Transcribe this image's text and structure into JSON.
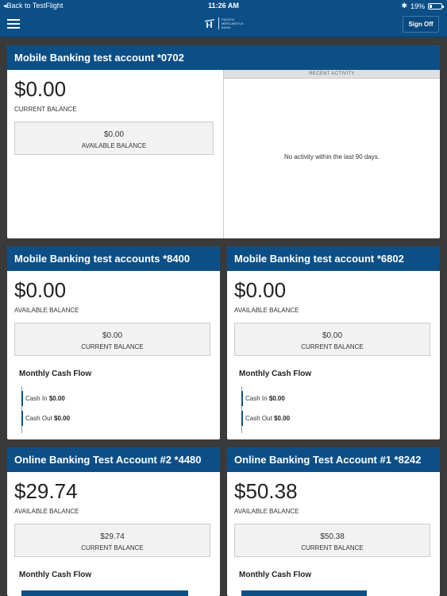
{
  "status_bar": {
    "back": "Back to TestFlight",
    "time": "11:26 AM",
    "bluetooth": "✱",
    "battery": "19%"
  },
  "nav": {
    "logo_text": [
      "PACIFIC",
      "MERCANTILE",
      "BANK"
    ],
    "sign_off": "Sign Off"
  },
  "accounts": [
    {
      "title": "Mobile Banking test account *0702",
      "amount": "$0.00",
      "amount_label": "CURRENT BALANCE",
      "sub_amount": "$0.00",
      "sub_label": "AVAILABLE BALANCE",
      "recent_activity_header": "RECENT ACTIVITY",
      "recent_activity_message": "No activity within the last 90 days."
    },
    {
      "title": "Mobile Banking test accounts *8400",
      "amount": "$0.00",
      "amount_label": "AVAILABLE BALANCE",
      "sub_amount": "$0.00",
      "sub_label": "CURRENT BALANCE",
      "cash_flow_title": "Monthly Cash Flow",
      "cash_in_label": "Cash In",
      "cash_in_value": "$0.00",
      "cash_out_label": "Cash Out",
      "cash_out_value": "$0.00"
    },
    {
      "title": "Mobile Banking test account *6802",
      "amount": "$0.00",
      "amount_label": "AVAILABLE BALANCE",
      "sub_amount": "$0.00",
      "sub_label": "CURRENT BALANCE",
      "cash_flow_title": "Monthly Cash Flow",
      "cash_in_label": "Cash In",
      "cash_in_value": "$0.00",
      "cash_out_label": "Cash Out",
      "cash_out_value": "$0.00"
    },
    {
      "title": "Online Banking Test Account #2 *4480",
      "amount": "$29.74",
      "amount_label": "AVAILABLE BALANCE",
      "sub_amount": "$29.74",
      "sub_label": "CURRENT BALANCE",
      "cash_flow_title": "Monthly Cash Flow"
    },
    {
      "title": "Online Banking Test Account #1 *8242",
      "amount": "$50.38",
      "amount_label": "AVAILABLE BALANCE",
      "sub_amount": "$50.38",
      "sub_label": "CURRENT BALANCE",
      "cash_flow_title": "Monthly Cash Flow"
    }
  ],
  "colors": {
    "brand_blue": "#0c4f87",
    "page_background": "#3a3a3a"
  }
}
